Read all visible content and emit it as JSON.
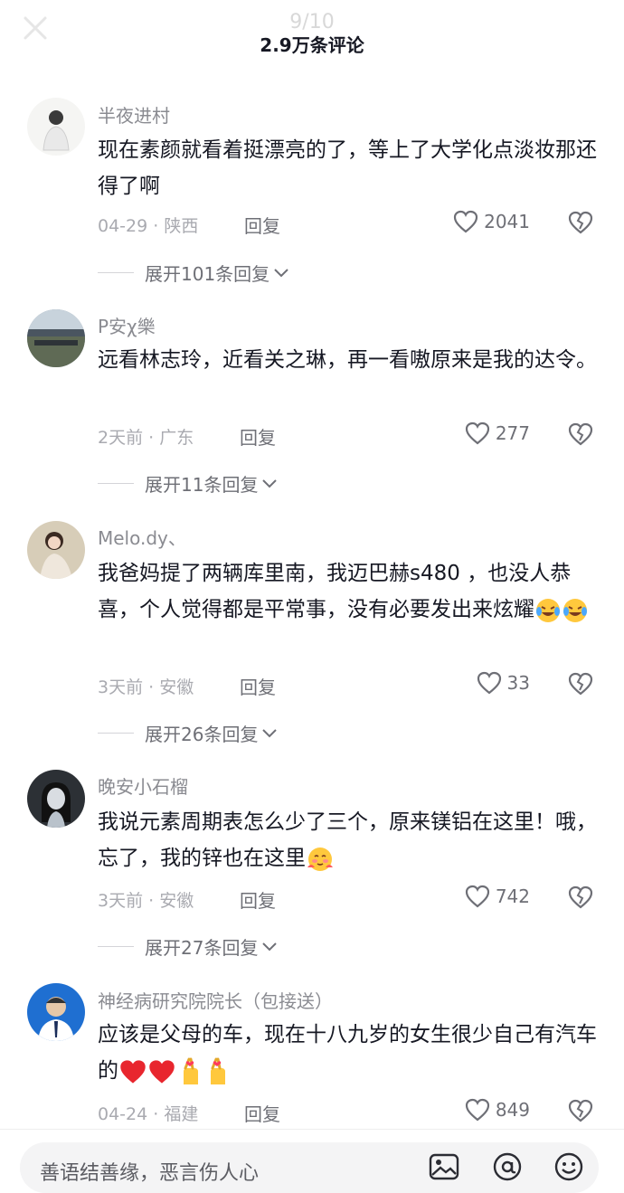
{
  "header": {
    "title": "2.9万条评论",
    "page_indicator": "9/10"
  },
  "comments": [
    {
      "username": "半夜进村",
      "text": "现在素颜就看着挺漂亮的了，等上了大学化点淡妆那还得了啊",
      "date": "04-29",
      "location": "陕西",
      "reply_label": "回复",
      "likes": "2041",
      "expand_label": "展开101条回复"
    },
    {
      "username": "P安χ樂",
      "text": "远看林志玲，近看关之琳，再一看嗷原来是我的达令。",
      "date": "2天前",
      "location": "广东",
      "reply_label": "回复",
      "likes": "277",
      "expand_label": "展开11条回复"
    },
    {
      "username": "Melo.dy、",
      "text": "我爸妈提了两辆库里南，我迈巴赫s480 ，也没人恭喜，个人觉得都是平常事，没有必要发出来炫耀",
      "date": "3天前",
      "location": "安徽",
      "reply_label": "回复",
      "likes": "33",
      "expand_label": "展开26条回复"
    },
    {
      "username": "晚安小石榴",
      "text": "我说元素周期表怎么少了三个，原来镁铝在这里！哦，忘了，我的锌也在这里",
      "date": "3天前",
      "location": "安徽",
      "reply_label": "回复",
      "likes": "742",
      "expand_label": "展开27条回复"
    },
    {
      "username": "神经病研究院院长（包接送）",
      "text": "应该是父母的车，现在十八九岁的女生很少自己有汽车的",
      "date": "04-24",
      "location": "福建",
      "reply_label": "回复",
      "likes": "849"
    }
  ],
  "bottom_bar": {
    "placeholder": "善语结善缘，恶言伤人心"
  },
  "icons": {
    "close": "close-icon",
    "like": "heart-outline-icon",
    "dislike": "broken-heart-icon",
    "expand": "chevron-down-icon",
    "image": "image-icon",
    "mention": "at-icon",
    "emoji": "emoji-icon"
  },
  "colors": {
    "text": "#161823",
    "secondary": "#8a8b91",
    "background": "#ffffff"
  }
}
